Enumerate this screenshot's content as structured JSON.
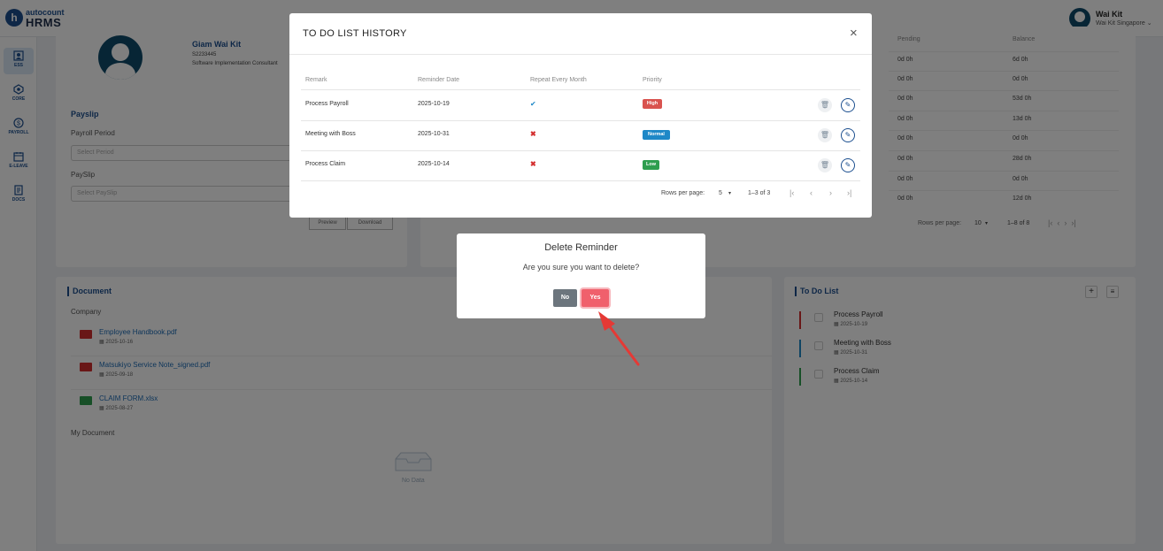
{
  "app": {
    "logo_top": "autocount",
    "logo_bottom": "HRMS",
    "logo_letter": "h"
  },
  "user": {
    "name": "Wai Kit",
    "company": "Wai Kit Singapore ⌄"
  },
  "sidebar": {
    "items": [
      {
        "label": "ESS",
        "icon": "ess-icon"
      },
      {
        "label": "CORE",
        "icon": "core-icon"
      },
      {
        "label": "PAYROLL",
        "icon": "payroll-icon"
      },
      {
        "label": "E-LEAVE",
        "icon": "calendar-icon"
      },
      {
        "label": "DOCS",
        "icon": "docs-icon"
      }
    ]
  },
  "profile": {
    "name": "Giam Wai Kit",
    "employee_id": "S2233445",
    "position": "Software Implementation Consultant"
  },
  "payslip": {
    "title": "Payslip",
    "period_label": "Payroll Period",
    "period_placeholder": "Select Period",
    "payslip_label": "PaySlip",
    "payslip_placeholder": "Select PaySlip",
    "preview": "Preview",
    "download": "Download"
  },
  "leave_table": {
    "headers": {
      "pending": "Pending",
      "balance": "Balance"
    },
    "rows": [
      {
        "pending": "0d 0h",
        "balance": "6d 0h"
      },
      {
        "pending": "0d 0h",
        "balance": "0d 0h"
      },
      {
        "pending": "0d 0h",
        "balance": "53d 0h"
      },
      {
        "pending": "0d 0h",
        "balance": "13d 0h"
      },
      {
        "pending": "0d 0h",
        "balance": "0d 0h"
      },
      {
        "pending": "0d 0h",
        "balance": "28d 0h"
      },
      {
        "pending": "0d 0h",
        "balance": "0d 0h"
      },
      {
        "pending": "0d 0h",
        "balance": "12d 0h"
      }
    ],
    "rows_per_page_label": "Rows per page:",
    "rows_per_page": "10",
    "range": "1–8 of 8"
  },
  "document": {
    "title": "Document",
    "company_label": "Company",
    "files": [
      {
        "name": "Employee Handbook.pdf",
        "date": "2025-10-16",
        "type": "pdf"
      },
      {
        "name": "Matsukiyo Service Note_signed.pdf",
        "date": "2025-09-18",
        "type": "pdf"
      },
      {
        "name": "CLAIM FORM.xlsx",
        "date": "2025-08-27",
        "type": "xlsx"
      }
    ],
    "my_document_label": "My Document",
    "no_data": "No Data"
  },
  "todo": {
    "title": "To Do List",
    "items": [
      {
        "text": "Process Payroll",
        "date": "2025-10-19",
        "color": "#d32f2f"
      },
      {
        "text": "Meeting with Boss",
        "date": "2025-10-31",
        "color": "#1e88c7"
      },
      {
        "text": "Process Claim",
        "date": "2025-10-14",
        "color": "#2e9e4f"
      }
    ]
  },
  "history_modal": {
    "title": "TO DO LIST HISTORY",
    "close": "×",
    "headers": {
      "remark": "Remark",
      "reminder_date": "Reminder Date",
      "repeat": "Repeat Every Month",
      "priority": "Priority"
    },
    "rows": [
      {
        "remark": "Process Payroll",
        "date": "2025-10-19",
        "repeat": "✔",
        "priority": "High",
        "priority_color": "#d9534f"
      },
      {
        "remark": "Meeting with Boss",
        "date": "2025-10-31",
        "repeat": "✖",
        "priority": "Normal",
        "priority_color": "#1e88c7"
      },
      {
        "remark": "Process Claim",
        "date": "2025-10-14",
        "repeat": "✖",
        "priority": "Low",
        "priority_color": "#2e9e4f"
      }
    ],
    "rows_per_page_label": "Rows per page:",
    "rows_per_page": "5",
    "range": "1–3 of 3"
  },
  "confirm_dialog": {
    "title": "Delete Reminder",
    "message": "Are you sure you want to delete?",
    "no": "No",
    "yes": "Yes"
  }
}
